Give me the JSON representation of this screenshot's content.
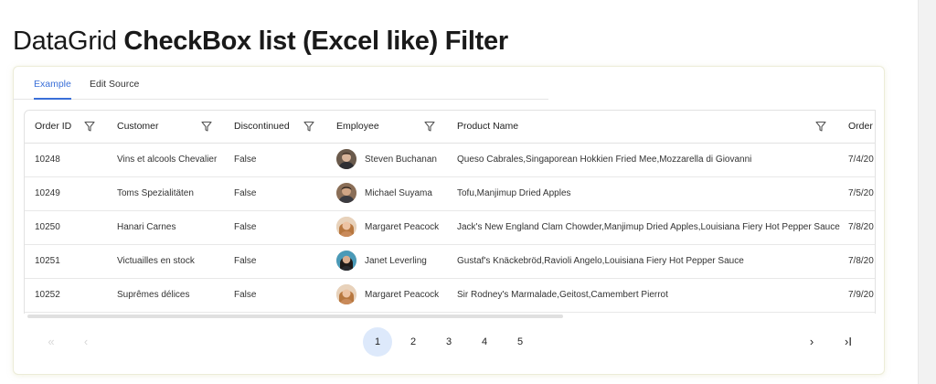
{
  "heading": {
    "light": "DataGrid",
    "bold": "CheckBox list (Excel like) Filter"
  },
  "tabs": [
    {
      "label": "Example",
      "active": true
    },
    {
      "label": "Edit Source",
      "active": false
    }
  ],
  "grid": {
    "columns": [
      "Order ID",
      "Customer",
      "Discontinued",
      "Employee",
      "Product Name",
      "Order I"
    ],
    "filter_icon": "filter-icon",
    "rows": [
      {
        "order_id": "10248",
        "customer": "Vins et alcools Chevalier",
        "discontinued": "False",
        "employee": "Steven Buchanan",
        "products": "Queso Cabrales,Singaporean Hokkien Fried Mee,Mozzarella di Giovanni",
        "order_date": "7/4/20"
      },
      {
        "order_id": "10249",
        "customer": "Toms Spezialitäten",
        "discontinued": "False",
        "employee": "Michael Suyama",
        "products": "Tofu,Manjimup Dried Apples",
        "order_date": "7/5/20"
      },
      {
        "order_id": "10250",
        "customer": "Hanari Carnes",
        "discontinued": "False",
        "employee": "Margaret Peacock",
        "products": "Jack's New England Clam Chowder,Manjimup Dried Apples,Louisiana Fiery Hot Pepper Sauce",
        "order_date": "7/8/20"
      },
      {
        "order_id": "10251",
        "customer": "Victuailles en stock",
        "discontinued": "False",
        "employee": "Janet Leverling",
        "products": "Gustaf's Knäckebröd,Ravioli Angelo,Louisiana Fiery Hot Pepper Sauce",
        "order_date": "7/8/20"
      },
      {
        "order_id": "10252",
        "customer": "Suprêmes délices",
        "discontinued": "False",
        "employee": "Margaret Peacock",
        "products": "Sir Rodney's Marmalade,Geitost,Camembert Pierrot",
        "order_date": "7/9/20"
      }
    ]
  },
  "pager": {
    "first": "«",
    "prev": "‹",
    "pages": [
      "1",
      "2",
      "3",
      "4",
      "5"
    ],
    "current": "1",
    "next": "›",
    "last": "›I"
  },
  "colors": {
    "accent": "#3a6fd8",
    "active_page_bg": "#dde9fb"
  }
}
